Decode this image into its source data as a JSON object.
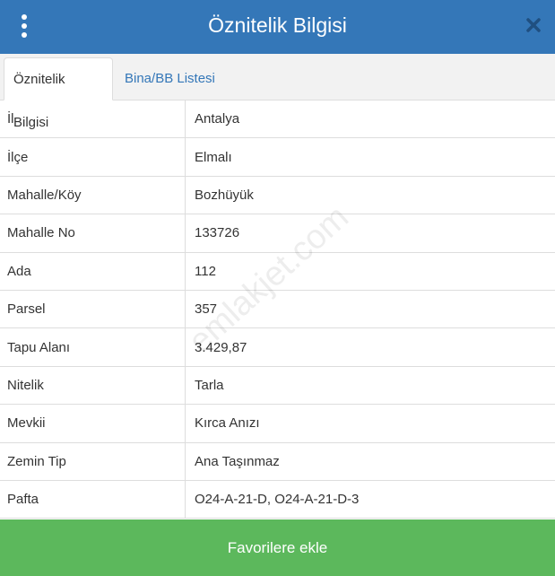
{
  "header": {
    "title": "Öznitelik Bilgisi",
    "menu_icon": "vertical-ellipsis-icon",
    "close_icon": "close-icon",
    "bg_color": "#3477b8"
  },
  "tabs": [
    {
      "label": "Öznitelik Bilgisi",
      "active": true
    },
    {
      "label": "Bina/BB Listesi",
      "active": false
    }
  ],
  "rows": [
    {
      "key": "İl",
      "value": "Antalya"
    },
    {
      "key": "İlçe",
      "value": "Elmalı"
    },
    {
      "key": "Mahalle/Köy",
      "value": "Bozhüyük"
    },
    {
      "key": "Mahalle No",
      "value": "133726"
    },
    {
      "key": "Ada",
      "value": "112"
    },
    {
      "key": "Parsel",
      "value": "357"
    },
    {
      "key": "Tapu Alanı",
      "value": "3.429,87"
    },
    {
      "key": "Nitelik",
      "value": "Tarla"
    },
    {
      "key": "Mevkii",
      "value": "Kırca Anızı"
    },
    {
      "key": "Zemin Tip",
      "value": "Ana Taşınmaz"
    },
    {
      "key": "Pafta",
      "value": "O24-A-21-D, O24-A-21-D-3"
    }
  ],
  "watermark": "emlakjet.com",
  "footer": {
    "button_label": "Favorilere ekle",
    "color": "#5cb85c"
  }
}
